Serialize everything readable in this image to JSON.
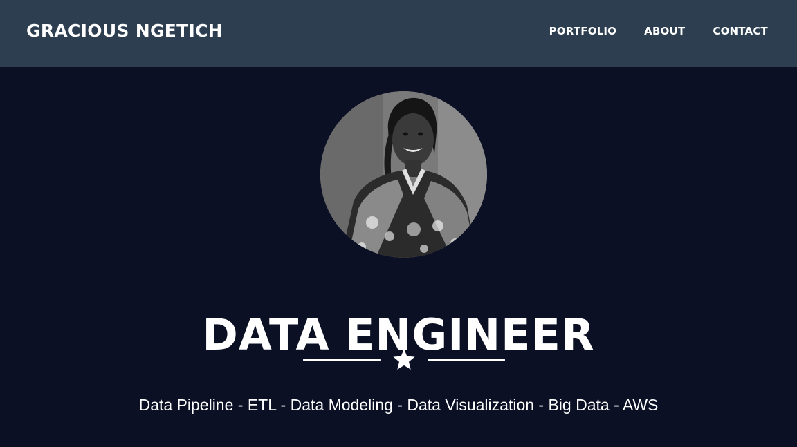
{
  "navbar": {
    "brand": "GRACIOUS NGETICH",
    "links": [
      {
        "label": "PORTFOLIO"
      },
      {
        "label": "ABOUT"
      },
      {
        "label": "CONTACT"
      }
    ],
    "background": "#2c3e50"
  },
  "hero": {
    "heading": "DATA ENGINEER",
    "divider_icon": "star-icon",
    "subheading": "Data Pipeline - ETL - Data Modeling - Data Visualization - Big Data - AWS",
    "background": "#0b1024",
    "avatar_icon": "profile-photo"
  }
}
